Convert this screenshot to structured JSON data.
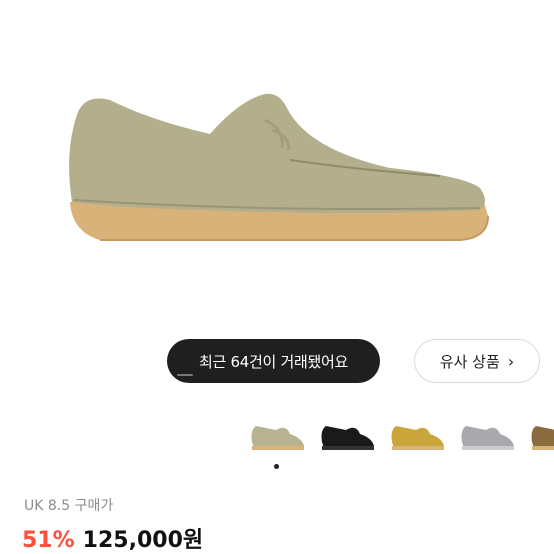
{
  "product": {
    "image_icon": "suede-wallabee-shoe",
    "main_color": "#b3ae8c",
    "sole_color": "#d9b27a"
  },
  "trade_banner": {
    "text": "최근 64건이 거래됐어요"
  },
  "similar_button": {
    "label": "유사 상품",
    "icon": "chevron-right-icon"
  },
  "thumbnails": [
    {
      "name": "thumb-olive",
      "color": "#b7b290"
    },
    {
      "name": "thumb-black",
      "color": "#1a1a1a"
    },
    {
      "name": "thumb-yellow",
      "color": "#c9a53c"
    },
    {
      "name": "thumb-grey",
      "color": "#a8a8ad"
    },
    {
      "name": "thumb-brown",
      "color": "#8a6b3e"
    }
  ],
  "pagination": {
    "current": 1
  },
  "size": {
    "label": "UK 8.5 구매가"
  },
  "price": {
    "discount": "51%",
    "amount": "125,000원"
  }
}
